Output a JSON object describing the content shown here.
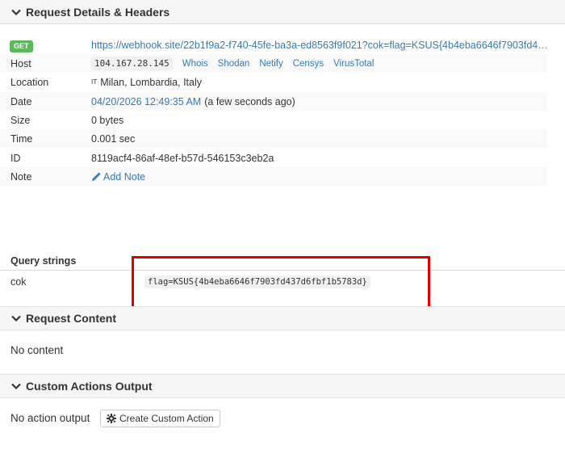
{
  "request_details": {
    "title": "Request Details & Headers",
    "method": "GET",
    "url": "https://webhook.site/22b1f9a2-f740-45fe-ba3a-ed8563f9f021?cok=flag=KSUS{4b4eba6646f7903fd4…",
    "host_label": "Host",
    "host_ip": "104.167.28.145",
    "host_tools": [
      "Whois",
      "Shodan",
      "Netify",
      "Censys",
      "VirusTotal"
    ],
    "location_label": "Location",
    "location_country": "IT",
    "location_value": "Milan, Lombardia, Italy",
    "date_label": "Date",
    "date_value": "04/20/2026 12:49:35 AM",
    "date_relative": "(a few seconds ago)",
    "size_label": "Size",
    "size_value": "0 bytes",
    "time_label": "Time",
    "time_value": "0.001 sec",
    "id_label": "ID",
    "id_value": "8119acf4-86af-48ef-b57d-546153c3eb2a",
    "note_label": "Note",
    "note_action": "Add Note"
  },
  "query_strings": {
    "title": "Query strings",
    "key": "cok",
    "value": "flag=KSUS{4b4eba6646f7903fd437d6fbf1b5783d}"
  },
  "request_content": {
    "title": "Request Content",
    "body": "No content"
  },
  "custom_actions": {
    "title": "Custom Actions Output",
    "body": "No action output",
    "button_label": "Create Custom Action"
  },
  "colors": {
    "get_badge": "#5cb85c",
    "link": "#337ab7",
    "highlight": "#e00000"
  }
}
